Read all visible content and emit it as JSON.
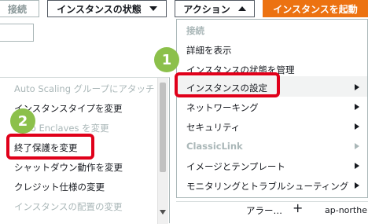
{
  "toolbar": {
    "connect_label": "接続",
    "instance_state_label": "インスタンスの状態",
    "actions_label": "アクション",
    "launch_label": "インスタンスを起動"
  },
  "left_menu": {
    "items": [
      {
        "label": "Auto Scaling グループにアタッチ",
        "disabled": true
      },
      {
        "label": "インスタンスタイプを変更",
        "disabled": false
      },
      {
        "label": "Nitro Enclaves を変更",
        "disabled": true
      },
      {
        "label": "終了保護を変更",
        "disabled": false
      },
      {
        "label": "シャットダウン動作を変更",
        "disabled": false
      },
      {
        "label": "クレジット仕様の変更",
        "disabled": false
      },
      {
        "label": "インスタンスの配置の変更",
        "disabled": true
      }
    ]
  },
  "right_menu": {
    "items": [
      {
        "label": "接続",
        "disabled": true
      },
      {
        "label": "詳細を表示",
        "disabled": false
      },
      {
        "label": "インスタンスの状態を管理",
        "disabled": false
      },
      {
        "label": "インスタンスの設定",
        "disabled": false,
        "submenu": true
      },
      {
        "label": "ネットワーキング",
        "disabled": false,
        "submenu": true
      },
      {
        "label": "セキュリティ",
        "disabled": false,
        "submenu": true
      },
      {
        "label": "ClassicLink",
        "disabled": true,
        "submenu": true
      },
      {
        "label": "イメージとテンプレート",
        "disabled": false,
        "submenu": true
      },
      {
        "label": "モニタリングとトラブルシューティング",
        "disabled": false,
        "submenu": true
      }
    ]
  },
  "table_footer": {
    "alarm_label": "アラー…",
    "plus_label": "+",
    "region_label": "ap-northe"
  },
  "annotations": {
    "badge_1": "1",
    "badge_2": "2"
  },
  "colors": {
    "launch_button": "#ec7211",
    "annotation_red": "#e0001a",
    "badge_green": "#8cc04b",
    "hover_row": "#f2f3f3"
  }
}
